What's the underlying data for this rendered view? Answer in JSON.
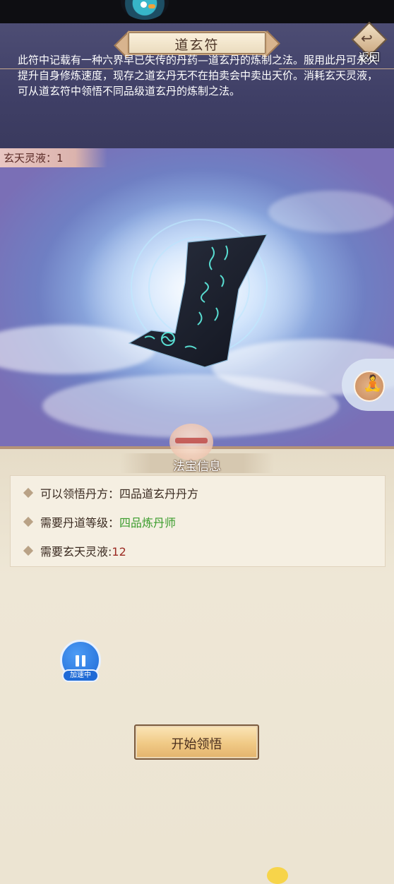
{
  "header": {
    "title": "道玄符",
    "back_label": "返回",
    "description": "此符中记载有一种六界早已失传的丹药—道玄丹的炼制之法。服用此丹可永久提升自身修炼速度，现存之道玄丹无不在拍卖会中卖出天价。消耗玄天灵液，可从道玄符中领悟不同品级道玄丹的炼制之法。"
  },
  "resource": {
    "label": "玄天灵液：1"
  },
  "info": {
    "tab_label": "法宝信息",
    "rows": [
      {
        "label": "可以领悟丹方：",
        "value": "四品道玄丹丹方"
      },
      {
        "label": "需要丹道等级：",
        "value": "四品炼丹师"
      },
      {
        "label": "需要玄天灵液:",
        "value": "12"
      }
    ]
  },
  "overlay": {
    "speed_badge": "加速中"
  },
  "action": {
    "start_label": "开始领悟"
  },
  "colors": {
    "header_bg": "#45456c",
    "panel_bg": "#ece4d2",
    "green_value": "#3a9c2c",
    "red_value": "#9b2a22",
    "button_gold": "#f0c985"
  },
  "icons": [
    "bird-mascot-icon",
    "back-arrow-icon",
    "meditation-figure-icon",
    "pause-icon",
    "mascot-icon"
  ]
}
